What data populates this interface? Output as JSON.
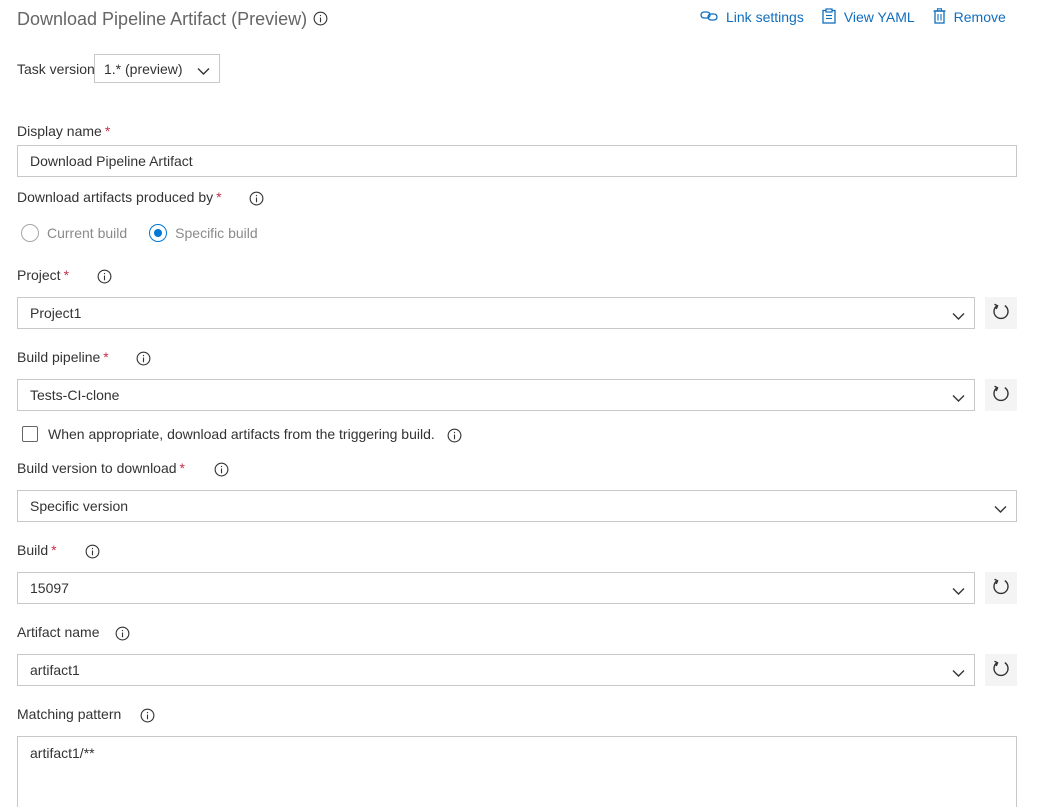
{
  "header": {
    "title": "Download Pipeline Artifact (Preview)",
    "actions": {
      "link_settings": "Link settings",
      "view_yaml": "View YAML",
      "remove": "Remove"
    }
  },
  "task_version": {
    "label": "Task version",
    "value": "1.* (preview)"
  },
  "display_name": {
    "label": "Display name",
    "required": "*",
    "value": "Download Pipeline Artifact"
  },
  "produced_by": {
    "label": "Download artifacts produced by",
    "required": "*",
    "options": [
      "Current build",
      "Specific build"
    ],
    "selected": "Specific build"
  },
  "project": {
    "label": "Project",
    "required": "*",
    "value": "Project1"
  },
  "build_pipeline": {
    "label": "Build pipeline",
    "required": "*",
    "value": "Tests-CI-clone"
  },
  "triggering_build": {
    "label": "When appropriate, download artifacts from the triggering build.",
    "checked": false
  },
  "build_version": {
    "label": "Build version to download",
    "required": "*",
    "value": "Specific version"
  },
  "build": {
    "label": "Build",
    "required": "*",
    "value": "15097"
  },
  "artifact_name": {
    "label": "Artifact name",
    "value": "artifact1"
  },
  "matching_pattern": {
    "label": "Matching pattern",
    "value": "artifact1/**"
  },
  "colors": {
    "accent": "#0078d4",
    "link": "#106ebe",
    "required": "#c4314b",
    "border": "#c8c8c8"
  },
  "icons": {
    "info": "info-icon",
    "link": "link-icon",
    "yaml": "clipboard-icon",
    "remove": "trash-icon",
    "chevron": "chevron-down-icon",
    "refresh": "refresh-icon"
  }
}
